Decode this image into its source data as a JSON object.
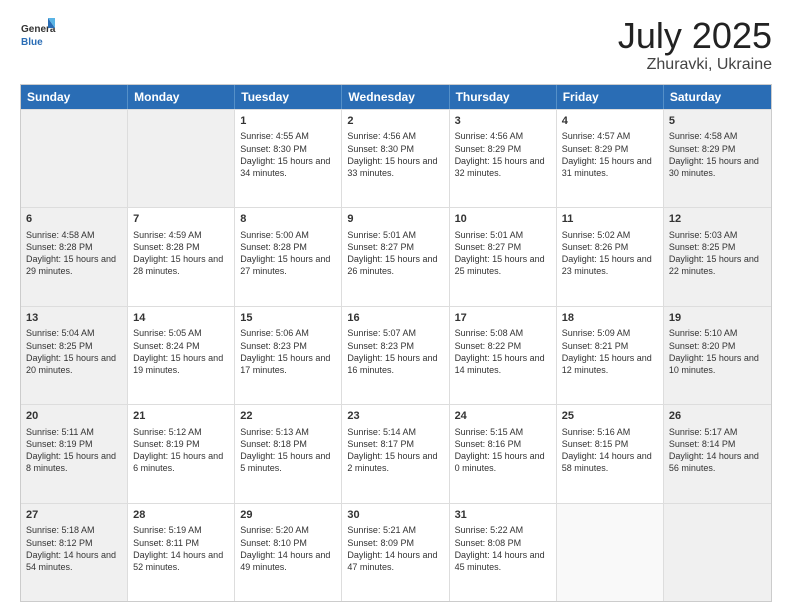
{
  "header": {
    "logo_general": "General",
    "logo_blue": "Blue",
    "month_title": "July 2025",
    "location": "Zhuravki, Ukraine"
  },
  "weekdays": [
    "Sunday",
    "Monday",
    "Tuesday",
    "Wednesday",
    "Thursday",
    "Friday",
    "Saturday"
  ],
  "rows": [
    [
      {
        "day": "",
        "text": "",
        "shaded": true,
        "empty": true
      },
      {
        "day": "",
        "text": "",
        "shaded": true,
        "empty": true
      },
      {
        "day": "1",
        "text": "Sunrise: 4:55 AM\nSunset: 8:30 PM\nDaylight: 15 hours and 34 minutes."
      },
      {
        "day": "2",
        "text": "Sunrise: 4:56 AM\nSunset: 8:30 PM\nDaylight: 15 hours and 33 minutes."
      },
      {
        "day": "3",
        "text": "Sunrise: 4:56 AM\nSunset: 8:29 PM\nDaylight: 15 hours and 32 minutes."
      },
      {
        "day": "4",
        "text": "Sunrise: 4:57 AM\nSunset: 8:29 PM\nDaylight: 15 hours and 31 minutes."
      },
      {
        "day": "5",
        "text": "Sunrise: 4:58 AM\nSunset: 8:29 PM\nDaylight: 15 hours and 30 minutes.",
        "shaded": true
      }
    ],
    [
      {
        "day": "6",
        "text": "Sunrise: 4:58 AM\nSunset: 8:28 PM\nDaylight: 15 hours and 29 minutes.",
        "shaded": true
      },
      {
        "day": "7",
        "text": "Sunrise: 4:59 AM\nSunset: 8:28 PM\nDaylight: 15 hours and 28 minutes."
      },
      {
        "day": "8",
        "text": "Sunrise: 5:00 AM\nSunset: 8:28 PM\nDaylight: 15 hours and 27 minutes."
      },
      {
        "day": "9",
        "text": "Sunrise: 5:01 AM\nSunset: 8:27 PM\nDaylight: 15 hours and 26 minutes."
      },
      {
        "day": "10",
        "text": "Sunrise: 5:01 AM\nSunset: 8:27 PM\nDaylight: 15 hours and 25 minutes."
      },
      {
        "day": "11",
        "text": "Sunrise: 5:02 AM\nSunset: 8:26 PM\nDaylight: 15 hours and 23 minutes."
      },
      {
        "day": "12",
        "text": "Sunrise: 5:03 AM\nSunset: 8:25 PM\nDaylight: 15 hours and 22 minutes.",
        "shaded": true
      }
    ],
    [
      {
        "day": "13",
        "text": "Sunrise: 5:04 AM\nSunset: 8:25 PM\nDaylight: 15 hours and 20 minutes.",
        "shaded": true
      },
      {
        "day": "14",
        "text": "Sunrise: 5:05 AM\nSunset: 8:24 PM\nDaylight: 15 hours and 19 minutes."
      },
      {
        "day": "15",
        "text": "Sunrise: 5:06 AM\nSunset: 8:23 PM\nDaylight: 15 hours and 17 minutes."
      },
      {
        "day": "16",
        "text": "Sunrise: 5:07 AM\nSunset: 8:23 PM\nDaylight: 15 hours and 16 minutes."
      },
      {
        "day": "17",
        "text": "Sunrise: 5:08 AM\nSunset: 8:22 PM\nDaylight: 15 hours and 14 minutes."
      },
      {
        "day": "18",
        "text": "Sunrise: 5:09 AM\nSunset: 8:21 PM\nDaylight: 15 hours and 12 minutes."
      },
      {
        "day": "19",
        "text": "Sunrise: 5:10 AM\nSunset: 8:20 PM\nDaylight: 15 hours and 10 minutes.",
        "shaded": true
      }
    ],
    [
      {
        "day": "20",
        "text": "Sunrise: 5:11 AM\nSunset: 8:19 PM\nDaylight: 15 hours and 8 minutes.",
        "shaded": true
      },
      {
        "day": "21",
        "text": "Sunrise: 5:12 AM\nSunset: 8:19 PM\nDaylight: 15 hours and 6 minutes."
      },
      {
        "day": "22",
        "text": "Sunrise: 5:13 AM\nSunset: 8:18 PM\nDaylight: 15 hours and 5 minutes."
      },
      {
        "day": "23",
        "text": "Sunrise: 5:14 AM\nSunset: 8:17 PM\nDaylight: 15 hours and 2 minutes."
      },
      {
        "day": "24",
        "text": "Sunrise: 5:15 AM\nSunset: 8:16 PM\nDaylight: 15 hours and 0 minutes."
      },
      {
        "day": "25",
        "text": "Sunrise: 5:16 AM\nSunset: 8:15 PM\nDaylight: 14 hours and 58 minutes."
      },
      {
        "day": "26",
        "text": "Sunrise: 5:17 AM\nSunset: 8:14 PM\nDaylight: 14 hours and 56 minutes.",
        "shaded": true
      }
    ],
    [
      {
        "day": "27",
        "text": "Sunrise: 5:18 AM\nSunset: 8:12 PM\nDaylight: 14 hours and 54 minutes.",
        "shaded": true
      },
      {
        "day": "28",
        "text": "Sunrise: 5:19 AM\nSunset: 8:11 PM\nDaylight: 14 hours and 52 minutes."
      },
      {
        "day": "29",
        "text": "Sunrise: 5:20 AM\nSunset: 8:10 PM\nDaylight: 14 hours and 49 minutes."
      },
      {
        "day": "30",
        "text": "Sunrise: 5:21 AM\nSunset: 8:09 PM\nDaylight: 14 hours and 47 minutes."
      },
      {
        "day": "31",
        "text": "Sunrise: 5:22 AM\nSunset: 8:08 PM\nDaylight: 14 hours and 45 minutes."
      },
      {
        "day": "",
        "text": "",
        "empty": true
      },
      {
        "day": "",
        "text": "",
        "empty": true,
        "shaded": true
      }
    ]
  ]
}
